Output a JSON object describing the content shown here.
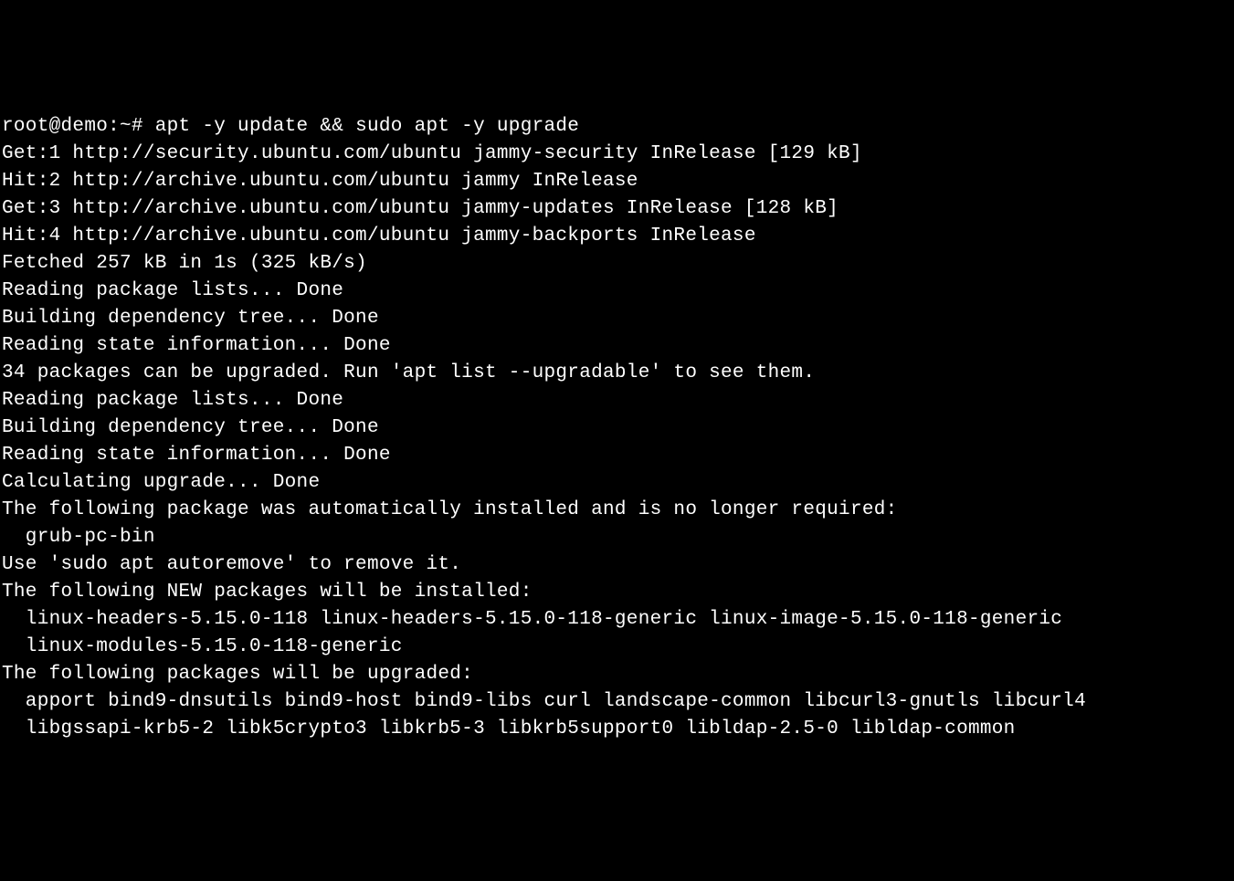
{
  "terminal": {
    "prompt": "root@demo:~# ",
    "command": "apt -y update && sudo apt -y upgrade",
    "lines": [
      "Get:1 http://security.ubuntu.com/ubuntu jammy-security InRelease [129 kB]",
      "Hit:2 http://archive.ubuntu.com/ubuntu jammy InRelease",
      "Get:3 http://archive.ubuntu.com/ubuntu jammy-updates InRelease [128 kB]",
      "Hit:4 http://archive.ubuntu.com/ubuntu jammy-backports InRelease",
      "Fetched 257 kB in 1s (325 kB/s)",
      "Reading package lists... Done",
      "Building dependency tree... Done",
      "Reading state information... Done",
      "34 packages can be upgraded. Run 'apt list --upgradable' to see them.",
      "Reading package lists... Done",
      "Building dependency tree... Done",
      "Reading state information... Done",
      "Calculating upgrade... Done",
      "The following package was automatically installed and is no longer required:",
      "  grub-pc-bin",
      "Use 'sudo apt autoremove' to remove it.",
      "The following NEW packages will be installed:",
      "  linux-headers-5.15.0-118 linux-headers-5.15.0-118-generic linux-image-5.15.0-118-generic",
      "  linux-modules-5.15.0-118-generic",
      "The following packages will be upgraded:",
      "  apport bind9-dnsutils bind9-host bind9-libs curl landscape-common libcurl3-gnutls libcurl4",
      "  libgssapi-krb5-2 libk5crypto3 libkrb5-3 libkrb5support0 libldap-2.5-0 libldap-common"
    ]
  }
}
